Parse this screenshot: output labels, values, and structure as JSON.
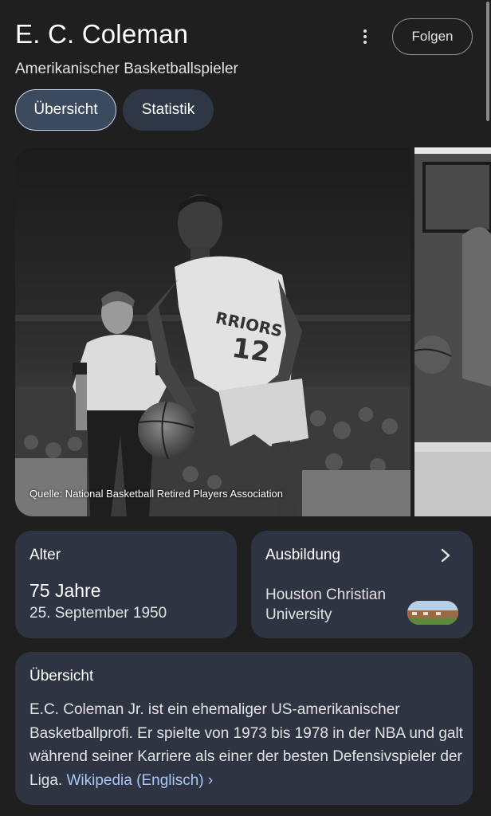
{
  "header": {
    "title": "E. C. Coleman",
    "subtitle": "Amerikanischer Basketballspieler",
    "follow_label": "Folgen",
    "more_icon": "more-vert-icon"
  },
  "tabs": [
    {
      "label": "Übersicht",
      "selected": true
    },
    {
      "label": "Statistik",
      "selected": false
    }
  ],
  "photo": {
    "caption": "Quelle: National Basketball Retired Players Association",
    "jersey_text": "RRIORS",
    "jersey_number": "12"
  },
  "cards": {
    "age": {
      "label": "Alter",
      "value": "75 Jahre",
      "date": "25. September 1950"
    },
    "education": {
      "label": "Ausbildung",
      "value": "Houston Christian University",
      "chevron_icon": "chevron-right-icon"
    },
    "overview": {
      "label": "Übersicht",
      "text": "E.C. Coleman Jr. ist ein ehemaliger US-amerikanischer Basketballprofi. Er spielte von 1973 bis 1978 in der NBA und galt während seiner Karriere als einer der besten Defensivspieler der Liga.",
      "link": "Wikipedia (Englisch) ›"
    }
  },
  "colors": {
    "background": "#1f1f1f",
    "card": "#2e3442",
    "selected_tab": "#3c4a5e",
    "link": "#a8c7fa"
  }
}
